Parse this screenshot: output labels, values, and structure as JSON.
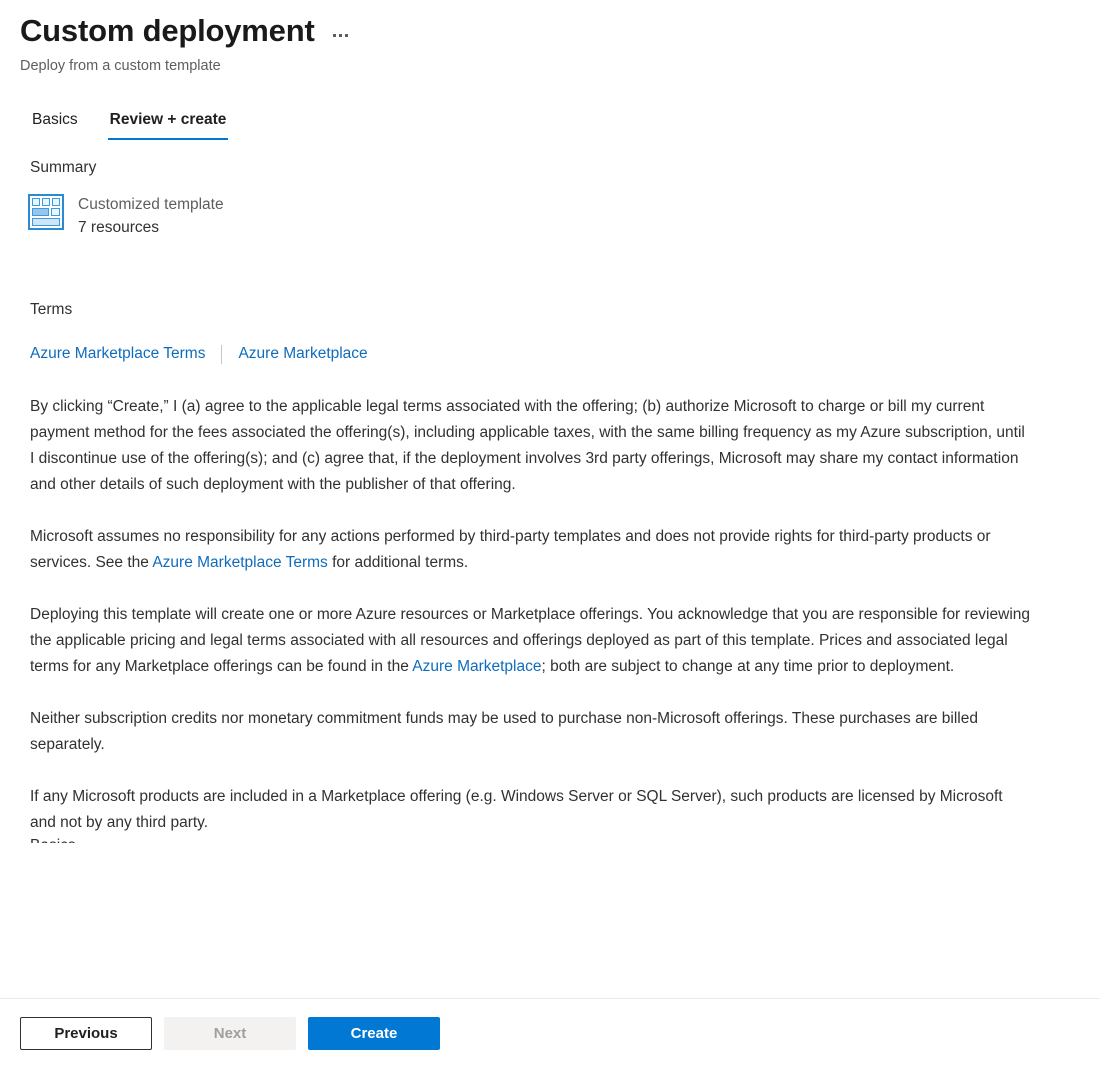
{
  "header": {
    "title": "Custom deployment",
    "subtitle": "Deploy from a custom template",
    "more_label": "More",
    "ellipsis_icon": "ellipsis-horizontal-icon"
  },
  "tabs": [
    {
      "label": "Basics",
      "active": false
    },
    {
      "label": "Review + create",
      "active": true
    }
  ],
  "summary": {
    "section_label": "Summary",
    "icon": "template-grid-icon",
    "template_name": "Customized template",
    "resource_count": "7 resources"
  },
  "terms": {
    "section_label": "Terms",
    "links": [
      {
        "label": "Azure Marketplace Terms"
      },
      {
        "label": "Azure Marketplace"
      }
    ],
    "paragraphs": [
      {
        "parts": [
          {
            "type": "text",
            "text": "By clicking “Create,” I (a) agree to the applicable legal terms associated with the offering; (b) authorize Microsoft to charge or bill my current payment method for the fees associated the offering(s), including applicable taxes, with the same billing frequency as my Azure subscription, until I discontinue use of the offering(s); and (c) agree that, if the deployment involves 3rd party offerings, Microsoft may share my contact information and other details of such deployment with the publisher of that offering."
          }
        ]
      },
      {
        "parts": [
          {
            "type": "text",
            "text": "Microsoft assumes no responsibility for any actions performed by third-party templates and does not provide rights for third-party products or services. See the "
          },
          {
            "type": "link",
            "text": "Azure Marketplace Terms"
          },
          {
            "type": "text",
            "text": " for additional terms."
          }
        ]
      },
      {
        "parts": [
          {
            "type": "text",
            "text": "Deploying this template will create one or more Azure resources or Marketplace offerings.  You acknowledge that you are responsible for reviewing the applicable pricing and legal terms associated with all resources and offerings deployed as part of this template.  Prices and associated legal terms for any Marketplace offerings can be found in the "
          },
          {
            "type": "link",
            "text": "Azure Marketplace"
          },
          {
            "type": "text",
            "text": "; both are subject to change at any time prior to deployment."
          }
        ]
      },
      {
        "parts": [
          {
            "type": "text",
            "text": "Neither subscription credits nor monetary commitment funds may be used to purchase non-Microsoft offerings. These purchases are billed separately."
          }
        ]
      },
      {
        "parts": [
          {
            "type": "text",
            "text": "If any Microsoft products are included in a Marketplace offering (e.g. Windows Server or SQL Server), such products are licensed by Microsoft and not by any third party."
          }
        ]
      }
    ],
    "clipped_next_heading": "Basics"
  },
  "footer": {
    "previous_label": "Previous",
    "next_label": "Next",
    "create_label": "Create"
  },
  "colors": {
    "accent": "#0078d4",
    "link": "#0f6cbd",
    "text": "#323130",
    "muted": "#605e5c",
    "divider": "#edebe9",
    "disabled_bg": "#f3f2f1",
    "disabled_text": "#a19f9d"
  }
}
